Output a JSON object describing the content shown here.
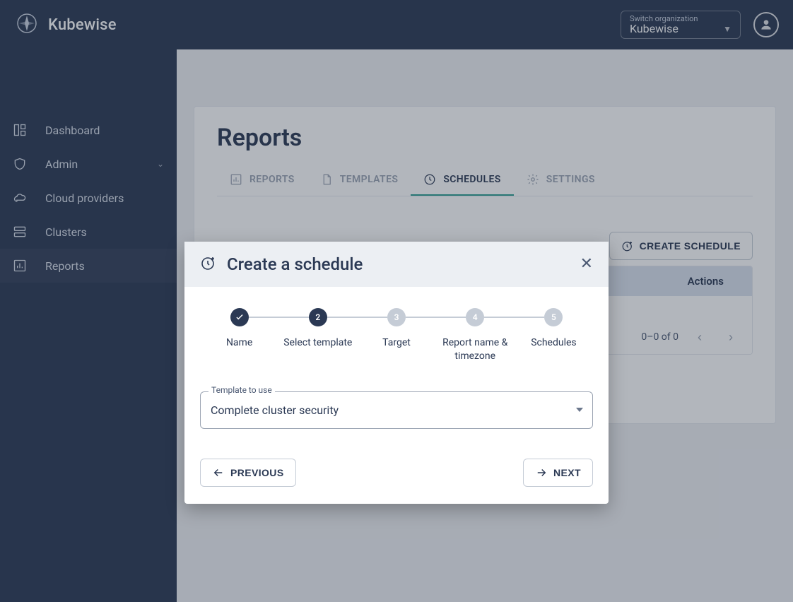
{
  "brand": {
    "name": "Kubewise"
  },
  "header": {
    "switch_label": "Switch organization",
    "org_name": "Kubewise"
  },
  "sidebar": {
    "items": [
      {
        "label": "Dashboard",
        "icon": "dashboard-icon",
        "expandable": false
      },
      {
        "label": "Admin",
        "icon": "shield-icon",
        "expandable": true
      },
      {
        "label": "Cloud providers",
        "icon": "cloud-icon",
        "expandable": false
      },
      {
        "label": "Clusters",
        "icon": "server-icon",
        "expandable": false
      },
      {
        "label": "Reports",
        "icon": "chart-icon",
        "expandable": false
      }
    ],
    "active_index": 4
  },
  "page": {
    "title": "Reports",
    "tabs": [
      {
        "label": "REPORTS",
        "icon": "chart-icon"
      },
      {
        "label": "TEMPLATES",
        "icon": "file-icon"
      },
      {
        "label": "SCHEDULES",
        "icon": "clock-icon"
      },
      {
        "label": "SETTINGS",
        "icon": "gear-icon"
      }
    ],
    "active_tab": 2,
    "create_button": "CREATE SCHEDULE",
    "table": {
      "columns": [
        "",
        "Actions"
      ],
      "pagination": "0–0 of 0"
    }
  },
  "dialog": {
    "title": "Create a schedule",
    "steps": [
      {
        "label": "Name",
        "state": "done"
      },
      {
        "label": "Select template",
        "state": "current",
        "number": "2"
      },
      {
        "label": "Target",
        "state": "pending",
        "number": "3"
      },
      {
        "label": "Report name & timezone",
        "state": "pending",
        "number": "4"
      },
      {
        "label": "Schedules",
        "state": "pending",
        "number": "5"
      }
    ],
    "field_label": "Template to use",
    "field_value": "Complete cluster security",
    "prev_label": "PREVIOUS",
    "next_label": "NEXT"
  }
}
